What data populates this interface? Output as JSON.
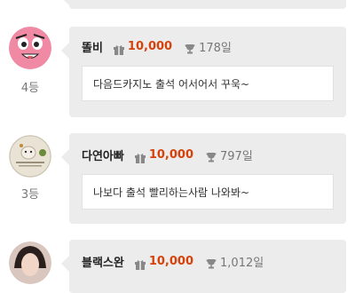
{
  "entries": [
    {
      "name": "똘비",
      "points": "10,000",
      "days": "178일",
      "rank": "4등",
      "message": "다음드카지노 출석 어서어서 꾸욱~"
    },
    {
      "name": "다연아빠",
      "points": "10,000",
      "days": "797일",
      "rank": "3등",
      "message": "나보다 출석 빨리하는사람 나와봐~"
    },
    {
      "name": "블랙스완",
      "points": "10,000",
      "days": "1,012일",
      "rank": "",
      "message": ""
    }
  ],
  "colors": {
    "points": "#d5420c",
    "card": "#ececec"
  },
  "icons": {
    "points": "gift-icon",
    "days": "trophy-icon"
  }
}
